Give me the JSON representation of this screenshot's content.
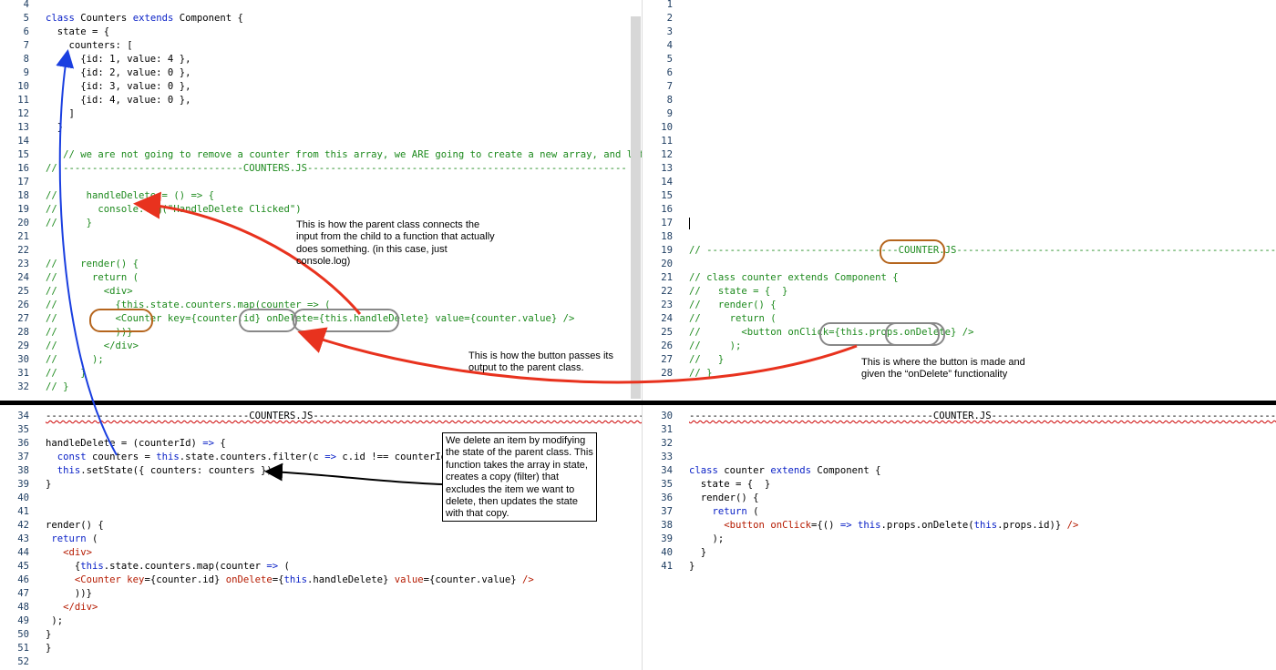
{
  "top_left": {
    "lines": [
      {
        "n": "4",
        "s": [
          [
            "",
            "t"
          ]
        ]
      },
      {
        "n": "5",
        "s": [
          [
            "class ",
            "k"
          ],
          [
            "Counters ",
            "t"
          ],
          [
            "extends ",
            "k"
          ],
          [
            "Component {",
            "t"
          ]
        ]
      },
      {
        "n": "6",
        "s": [
          [
            "  state = {",
            "t"
          ]
        ]
      },
      {
        "n": "7",
        "s": [
          [
            "    counters: [",
            "t"
          ]
        ]
      },
      {
        "n": "8",
        "s": [
          [
            "      {id: 1, value: 4 },",
            "t"
          ]
        ]
      },
      {
        "n": "9",
        "s": [
          [
            "      {id: 2, value: 0 },",
            "t"
          ]
        ]
      },
      {
        "n": "10",
        "s": [
          [
            "      {id: 3, value: 0 },",
            "t"
          ]
        ]
      },
      {
        "n": "11",
        "s": [
          [
            "      {id: 4, value: 0 },",
            "t"
          ]
        ]
      },
      {
        "n": "12",
        "s": [
          [
            "    ]",
            "t"
          ]
        ]
      },
      {
        "n": "13",
        "s": [
          [
            "  }",
            "t"
          ]
        ]
      },
      {
        "n": "14",
        "s": [
          [
            "",
            "t"
          ]
        ]
      },
      {
        "n": "15",
        "s": [
          [
            "   // we are not going to remove a counter from this array, we ARE going to create a new array, and let React d",
            "c"
          ]
        ]
      },
      {
        "n": "16",
        "s": [
          [
            "// -------------------------------COUNTERS.JS-------------------------------------------------------",
            "c"
          ]
        ]
      },
      {
        "n": "17",
        "s": [
          [
            "",
            "t"
          ]
        ]
      },
      {
        "n": "18",
        "s": [
          [
            "//     handleDelete = () => {",
            "c"
          ]
        ]
      },
      {
        "n": "19",
        "s": [
          [
            "//       console.log(\"HandleDelete Clicked\")",
            "c"
          ]
        ]
      },
      {
        "n": "20",
        "s": [
          [
            "//     }",
            "c"
          ]
        ]
      },
      {
        "n": "21",
        "s": [
          [
            "",
            "t"
          ]
        ]
      },
      {
        "n": "22",
        "s": [
          [
            "",
            "t"
          ]
        ]
      },
      {
        "n": "23",
        "s": [
          [
            "//    render() {",
            "c"
          ]
        ]
      },
      {
        "n": "24",
        "s": [
          [
            "//      return (",
            "c"
          ]
        ]
      },
      {
        "n": "25",
        "s": [
          [
            "//        <div>",
            "c"
          ]
        ]
      },
      {
        "n": "26",
        "s": [
          [
            "//          {this.state.counters.map(counter => (",
            "c"
          ]
        ]
      },
      {
        "n": "27",
        "s": [
          [
            "//          <Counter key={counter.id} onDelete={this.handleDelete} value={counter.value} />",
            "c"
          ]
        ]
      },
      {
        "n": "28",
        "s": [
          [
            "//          ))}",
            "c"
          ]
        ]
      },
      {
        "n": "29",
        "s": [
          [
            "//        </div>",
            "c"
          ]
        ]
      },
      {
        "n": "30",
        "s": [
          [
            "//      );",
            "c"
          ]
        ]
      },
      {
        "n": "31",
        "s": [
          [
            "//    }",
            "c"
          ]
        ]
      },
      {
        "n": "32",
        "s": [
          [
            "// }",
            "c"
          ]
        ]
      }
    ]
  },
  "top_right": {
    "lines": [
      {
        "n": "1",
        "s": [
          [
            "",
            "t"
          ]
        ]
      },
      {
        "n": "2",
        "s": [
          [
            "",
            "t"
          ]
        ]
      },
      {
        "n": "3",
        "s": [
          [
            "",
            "t"
          ]
        ]
      },
      {
        "n": "4",
        "s": [
          [
            "",
            "t"
          ]
        ]
      },
      {
        "n": "5",
        "s": [
          [
            "",
            "t"
          ]
        ]
      },
      {
        "n": "6",
        "s": [
          [
            "",
            "t"
          ]
        ]
      },
      {
        "n": "7",
        "s": [
          [
            "",
            "t"
          ]
        ]
      },
      {
        "n": "8",
        "s": [
          [
            "",
            "t"
          ]
        ]
      },
      {
        "n": "9",
        "s": [
          [
            "",
            "t"
          ]
        ]
      },
      {
        "n": "10",
        "s": [
          [
            "",
            "t"
          ]
        ]
      },
      {
        "n": "11",
        "s": [
          [
            "",
            "t"
          ]
        ]
      },
      {
        "n": "12",
        "s": [
          [
            "",
            "t"
          ]
        ]
      },
      {
        "n": "13",
        "s": [
          [
            "",
            "t"
          ]
        ]
      },
      {
        "n": "14",
        "s": [
          [
            "",
            "t"
          ]
        ]
      },
      {
        "n": "15",
        "s": [
          [
            "",
            "t"
          ]
        ]
      },
      {
        "n": "16",
        "s": [
          [
            "",
            "t"
          ]
        ]
      },
      {
        "n": "17",
        "s": [
          [
            "",
            "t"
          ]
        ]
      },
      {
        "n": "18",
        "s": [
          [
            "",
            "t"
          ]
        ]
      },
      {
        "n": "19",
        "s": [
          [
            "// ---------------------------------COUNTER.JS-----------------------------------------------------------",
            "c"
          ]
        ]
      },
      {
        "n": "20",
        "s": [
          [
            "",
            "t"
          ]
        ]
      },
      {
        "n": "21",
        "s": [
          [
            "// class counter extends Component {",
            "c"
          ]
        ]
      },
      {
        "n": "22",
        "s": [
          [
            "//   state = {  }",
            "c"
          ]
        ]
      },
      {
        "n": "23",
        "s": [
          [
            "//   render() {",
            "c"
          ]
        ]
      },
      {
        "n": "24",
        "s": [
          [
            "//     return (",
            "c"
          ]
        ]
      },
      {
        "n": "25",
        "s": [
          [
            "//       <button onClick={this.props.onDelete} />",
            "c"
          ]
        ]
      },
      {
        "n": "26",
        "s": [
          [
            "//     );",
            "c"
          ]
        ]
      },
      {
        "n": "27",
        "s": [
          [
            "//   }",
            "c"
          ]
        ]
      },
      {
        "n": "28",
        "s": [
          [
            "// }",
            "c"
          ]
        ]
      }
    ]
  },
  "bottom_left": {
    "lines": [
      {
        "n": "34",
        "s": [
          [
            "-----------------------------------COUNTERS.JS----------------------------------------------------------",
            "t sq"
          ]
        ]
      },
      {
        "n": "35",
        "s": [
          [
            "",
            "t"
          ]
        ]
      },
      {
        "n": "36",
        "s": [
          [
            "handleDelete = (counterId) ",
            "t"
          ],
          [
            "=>",
            "k"
          ],
          [
            " {",
            "t"
          ]
        ]
      },
      {
        "n": "37",
        "s": [
          [
            "  ",
            "t"
          ],
          [
            "const ",
            "k"
          ],
          [
            "counters = ",
            "t"
          ],
          [
            "this",
            "k"
          ],
          [
            ".state.counters.filter(c ",
            "t"
          ],
          [
            "=>",
            "k"
          ],
          [
            " c.id !== counterId)",
            "t"
          ]
        ]
      },
      {
        "n": "38",
        "s": [
          [
            "  ",
            "t"
          ],
          [
            "this",
            "k"
          ],
          [
            ".setState({ counters: counters })",
            "t"
          ]
        ]
      },
      {
        "n": "39",
        "s": [
          [
            "}",
            "t"
          ]
        ]
      },
      {
        "n": "40",
        "s": [
          [
            "",
            "t"
          ]
        ]
      },
      {
        "n": "41",
        "s": [
          [
            "",
            "t"
          ]
        ]
      },
      {
        "n": "42",
        "s": [
          [
            "render() {",
            "t"
          ]
        ]
      },
      {
        "n": "43",
        "s": [
          [
            " ",
            "t"
          ],
          [
            "return",
            "k"
          ],
          [
            " (",
            "t"
          ]
        ]
      },
      {
        "n": "44",
        "s": [
          [
            "   ",
            "t"
          ],
          [
            "<div>",
            "r"
          ]
        ]
      },
      {
        "n": "45",
        "s": [
          [
            "     {",
            "t"
          ],
          [
            "this",
            "k"
          ],
          [
            ".state.counters.map(counter ",
            "t"
          ],
          [
            "=>",
            "k"
          ],
          [
            " (",
            "t"
          ]
        ]
      },
      {
        "n": "46",
        "s": [
          [
            "     ",
            "t"
          ],
          [
            "<Counter ",
            "r"
          ],
          [
            "key",
            "r"
          ],
          [
            "={counter.id} ",
            "t"
          ],
          [
            "onDelete",
            "r"
          ],
          [
            "={",
            "t"
          ],
          [
            "this",
            "k"
          ],
          [
            ".handleDelete} ",
            "t"
          ],
          [
            "value",
            "r"
          ],
          [
            "={counter.value} ",
            "t"
          ],
          [
            "/>",
            "r"
          ]
        ]
      },
      {
        "n": "47",
        "s": [
          [
            "     ))}",
            "t"
          ]
        ]
      },
      {
        "n": "48",
        "s": [
          [
            "   ",
            "t"
          ],
          [
            "</div>",
            "r"
          ]
        ]
      },
      {
        "n": "49",
        "s": [
          [
            " );",
            "t"
          ]
        ]
      },
      {
        "n": "50",
        "s": [
          [
            "}",
            "t"
          ]
        ]
      },
      {
        "n": "51",
        "s": [
          [
            "}",
            "t"
          ]
        ]
      },
      {
        "n": "52",
        "s": [
          [
            "",
            "t"
          ]
        ]
      }
    ]
  },
  "bottom_right": {
    "lines": [
      {
        "n": "30",
        "s": [
          [
            "------------------------------------------COUNTER.JS----------------------------------------------------",
            "t sq"
          ]
        ]
      },
      {
        "n": "31",
        "s": [
          [
            "",
            "t"
          ]
        ]
      },
      {
        "n": "32",
        "s": [
          [
            "",
            "t"
          ]
        ]
      },
      {
        "n": "33",
        "s": [
          [
            "",
            "t"
          ]
        ]
      },
      {
        "n": "34",
        "s": [
          [
            "class ",
            "k"
          ],
          [
            "counter ",
            "t"
          ],
          [
            "extends ",
            "k"
          ],
          [
            "Component {",
            "t"
          ]
        ]
      },
      {
        "n": "35",
        "s": [
          [
            "  state = {  }",
            "t"
          ]
        ]
      },
      {
        "n": "36",
        "s": [
          [
            "  render() {",
            "t"
          ]
        ]
      },
      {
        "n": "37",
        "s": [
          [
            "    ",
            "t"
          ],
          [
            "return",
            "k"
          ],
          [
            " (",
            "t"
          ]
        ]
      },
      {
        "n": "38",
        "s": [
          [
            "      ",
            "t"
          ],
          [
            "<button ",
            "r"
          ],
          [
            "onClick",
            "r"
          ],
          [
            "={() ",
            "t"
          ],
          [
            "=>",
            "k"
          ],
          [
            " ",
            "t"
          ],
          [
            "this",
            "k"
          ],
          [
            ".props.onDelete(",
            "t"
          ],
          [
            "this",
            "k"
          ],
          [
            ".props.id)} ",
            "t"
          ],
          [
            "/>",
            "r"
          ]
        ]
      },
      {
        "n": "39",
        "s": [
          [
            "    );",
            "t"
          ]
        ]
      },
      {
        "n": "40",
        "s": [
          [
            "  }",
            "t"
          ]
        ]
      },
      {
        "n": "41",
        "s": [
          [
            "}",
            "t"
          ]
        ]
      }
    ]
  },
  "notes": {
    "parent_connect": "This is how the parent class connects the input from the child to a function that actually does something. (in this case, just console.log)",
    "button_passes": "This is how the button passes its output to the parent class.",
    "button_made": "This is where the button is made and given the “onDelete” functionality",
    "delete_item": "We delete an item by modifying the state of the parent class. This function takes the array in state, creates a copy (filter) that excludes the item we want to delete, then updates the state with that copy."
  },
  "colors": {
    "keyword": "#0b22c7",
    "comment": "#1d8a1d",
    "jsx": "#b51a00",
    "line_number": "#1f3e62",
    "red_arrow": "#e8321e",
    "blue_arrow": "#1a3fe0",
    "highlight_orange": "#b5651d",
    "highlight_gray": "#888888"
  }
}
